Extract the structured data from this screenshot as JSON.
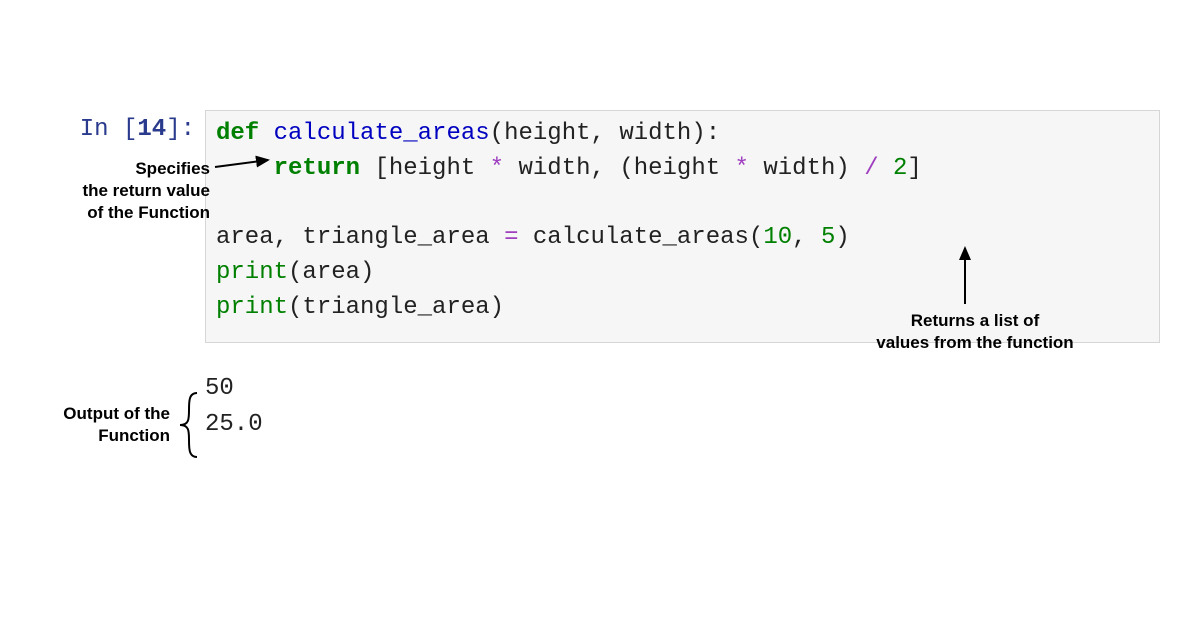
{
  "prompt": {
    "in_label": "In ",
    "open": "[",
    "num": "14",
    "close": "]:"
  },
  "code": {
    "line1": {
      "def": "def",
      "sp1": " ",
      "fn": "calculate_areas",
      "lp": "(",
      "p1": "height",
      "comma": ", ",
      "p2": "width",
      "rp": ")",
      "colon": ":"
    },
    "line2": {
      "indent": "    ",
      "ret": "return",
      "sp": " ",
      "lb": "[",
      "a": "height",
      "sp2": " ",
      "op1": "*",
      "sp3": " ",
      "b": "width",
      "comma": ", ",
      "lp": "(",
      "c": "height",
      "sp4": " ",
      "op2": "*",
      "sp5": " ",
      "d": "width",
      "rp": ")",
      "sp6": " ",
      "op3": "/",
      "sp7": " ",
      "two": "2",
      "rb": "]"
    },
    "blank": "",
    "line3": {
      "v1": "area",
      "comma": ", ",
      "v2": "triangle_area",
      "sp1": " ",
      "eq": "=",
      "sp2": " ",
      "fn": "calculate_areas",
      "lp": "(",
      "n1": "10",
      "comma2": ", ",
      "n2": "5",
      "rp": ")"
    },
    "line4": {
      "pr": "print",
      "lp": "(",
      "v": "area",
      "rp": ")"
    },
    "line5": {
      "pr": "print",
      "lp": "(",
      "v": "triangle_area",
      "rp": ")"
    }
  },
  "output": {
    "line1": "50",
    "line2": "25.0"
  },
  "annotations": {
    "return_spec": {
      "l1": "Specifies",
      "l2": "the return value",
      "l3": "of the Function"
    },
    "list_return": {
      "l1": "Returns a list of",
      "l2": "values from the function"
    },
    "output_label": {
      "l1": "Output of the",
      "l2": "Function"
    }
  }
}
